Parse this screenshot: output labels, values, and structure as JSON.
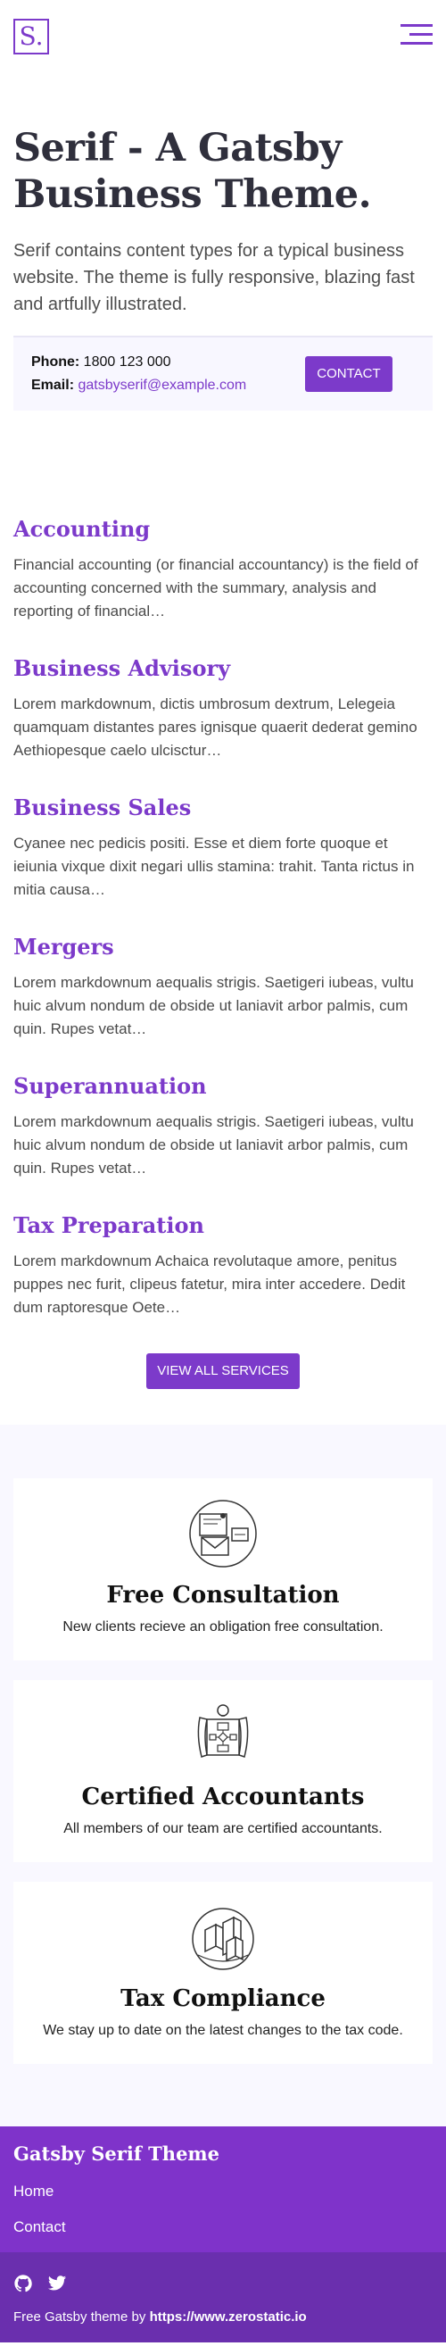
{
  "header": {
    "logo_text": "S.",
    "menu_icon": "hamburger-menu-icon"
  },
  "intro": {
    "title": "Serif - A Gatsby Business Theme.",
    "lead": "Serif contains content types for a typical business website. The theme is fully responsive, blazing fast and artfully illustrated."
  },
  "contact": {
    "phone_label": "Phone:",
    "phone_value": "1800 123 000",
    "email_label": "Email:",
    "email_value": "gatsbyserif@example.com",
    "button_label": "Contact"
  },
  "services": [
    {
      "title": "Accounting",
      "excerpt": "Financial accounting (or financial accountancy) is the field of accounting concerned with the summary, analysis and reporting of financial…"
    },
    {
      "title": "Business Advisory",
      "excerpt": "Lorem markdownum, dictis umbrosum dextrum, Lelegeia quamquam distantes pares ignisque quaerit dederat gemino Aethiopesque caelo ulcisctur…"
    },
    {
      "title": "Business Sales",
      "excerpt": "Cyanee nec pedicis positi. Esse et diem forte quoque et ieiunia vixque dixit negari ullis stamina: trahit. Tanta rictus in mitia causa…"
    },
    {
      "title": "Mergers",
      "excerpt": "Lorem markdownum aequalis strigis. Saetigeri iubeas, vultu huic alvum nondum de obside ut laniavit arbor palmis, cum quin. Rupes vetat…"
    },
    {
      "title": "Superannuation",
      "excerpt": "Lorem markdownum aequalis strigis. Saetigeri iubeas, vultu huic alvum nondum de obside ut laniavit arbor palmis, cum quin. Rupes vetat…"
    },
    {
      "title": "Tax Preparation",
      "excerpt": "Lorem markdownum Achaica revolutaque amore, penitus puppes nec furit, clipeus fatetur, mira inter accedere. Dedit dum raptoresque Oete…"
    }
  ],
  "services_button": "View All Services",
  "features": [
    {
      "icon": "consultation-illustration-icon",
      "title": "Free Consultation",
      "description": "New clients recieve an obligation free consultation."
    },
    {
      "icon": "accountants-illustration-icon",
      "title": "Certified Accountants",
      "description": "All members of our team are certified accountants."
    },
    {
      "icon": "tax-compliance-illustration-icon",
      "title": "Tax Compliance",
      "description": "We stay up to date on the latest changes to the tax code."
    }
  ],
  "footer": {
    "title": "Gatsby Serif Theme",
    "links": [
      "Home",
      "Contact"
    ],
    "social_icons": [
      "github-icon",
      "twitter-icon"
    ],
    "credit_prefix": "Free Gatsby theme by",
    "credit_link": "https://www.zerostatic.io"
  },
  "colors": {
    "accent": "#7c3aca",
    "footer_top": "#7f33ca",
    "footer_bottom": "#6a2fae",
    "features_bg": "#f9f8ff"
  }
}
